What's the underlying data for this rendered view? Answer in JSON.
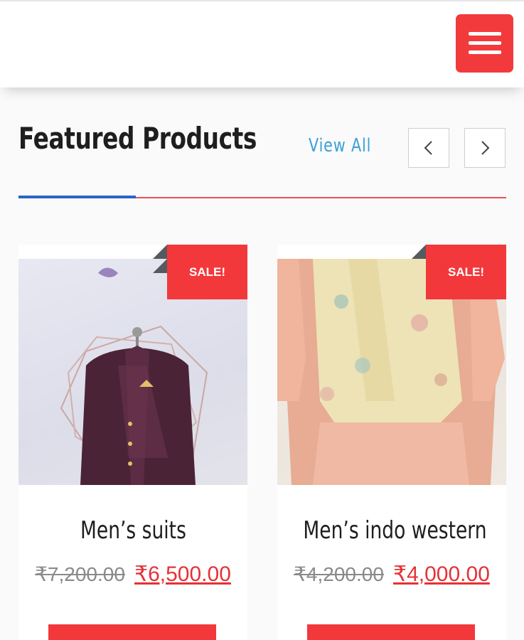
{
  "header": {
    "menu_icon": "hamburger-menu-icon",
    "accent_color": "#f23a3c"
  },
  "section": {
    "title": "Featured Products",
    "view_all_label": "View All",
    "prev_icon": "chevron-left-icon",
    "next_icon": "chevron-right-icon"
  },
  "products": [
    {
      "sale_label": "SALE!",
      "name": "Men’s suits",
      "old_price": "₹7,200.00",
      "new_price": "₹6,500.00"
    },
    {
      "sale_label": "SALE!",
      "name": "Men’s indo western",
      "old_price": "₹4,200.00",
      "new_price": "₹4,000.00"
    }
  ],
  "colors": {
    "sale_red": "#f3383b",
    "price_red": "#e53236",
    "link_blue": "#3a9fd8",
    "divider_blue": "#2a64c8"
  }
}
